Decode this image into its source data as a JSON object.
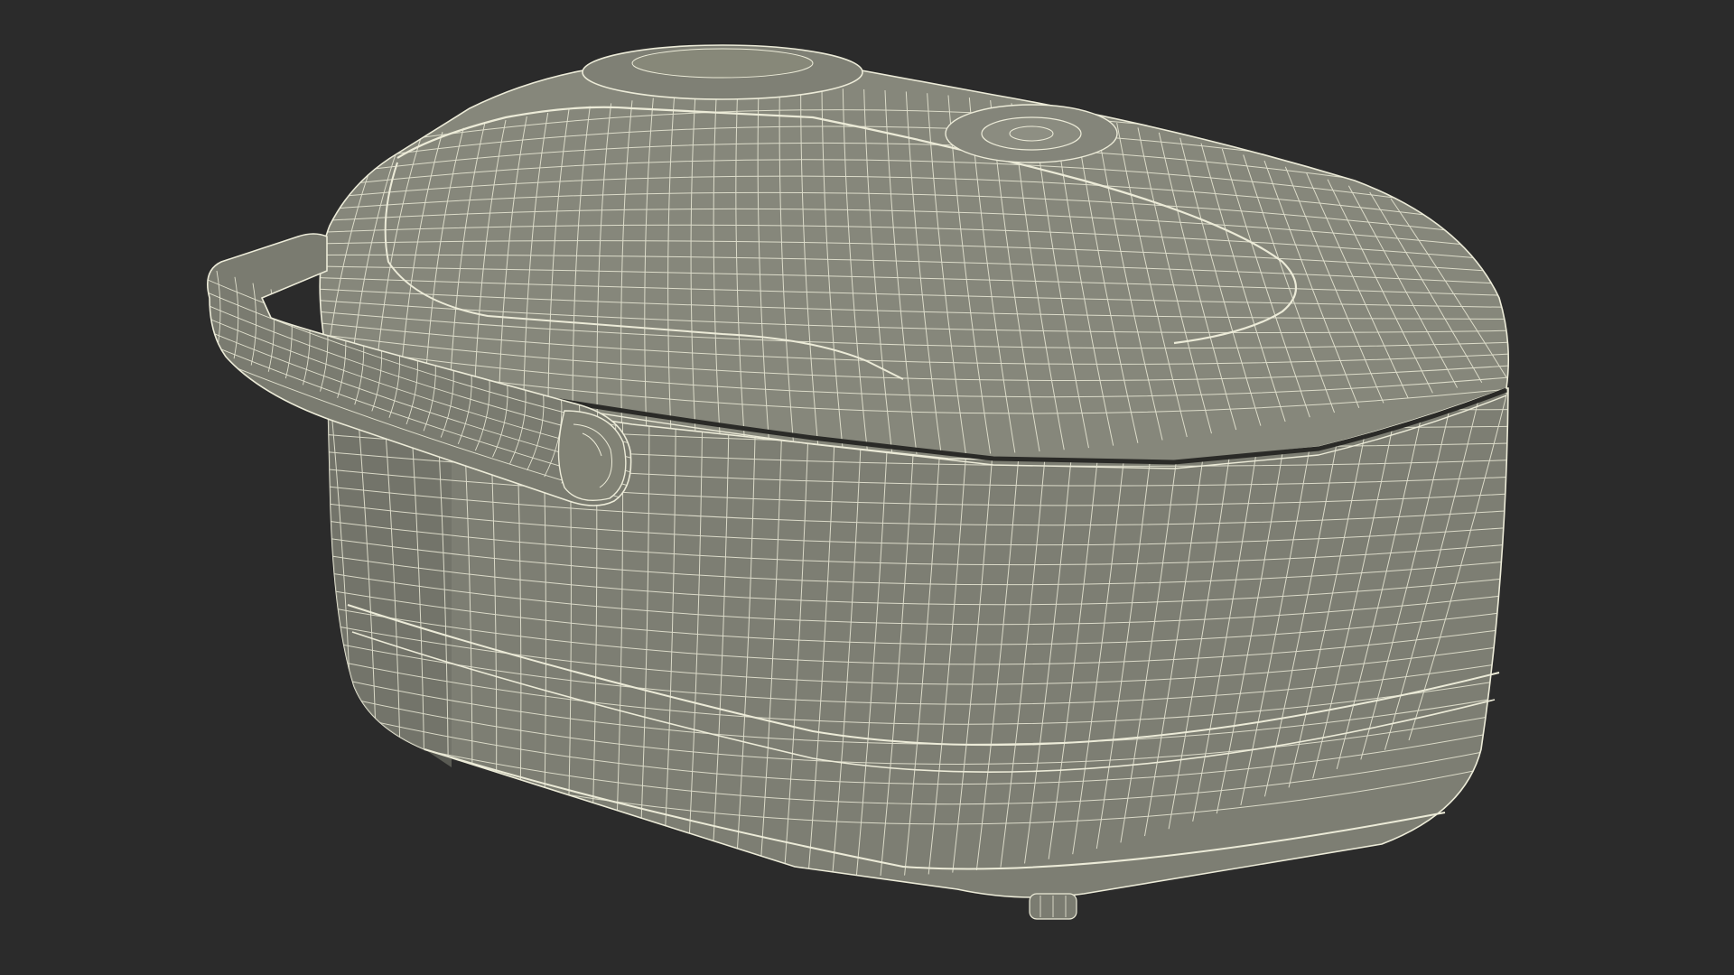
{
  "scene": {
    "subject_icon": "rice-cooker-wireframe-icon",
    "render_style": "wireframe",
    "colors": {
      "background": "#2b2b2b",
      "surface": "#7e7f74",
      "surface_light": "#8b8c80",
      "surface_dark": "#6f7066",
      "wire": "#ecebd8",
      "seam": "#2a2a27"
    }
  }
}
